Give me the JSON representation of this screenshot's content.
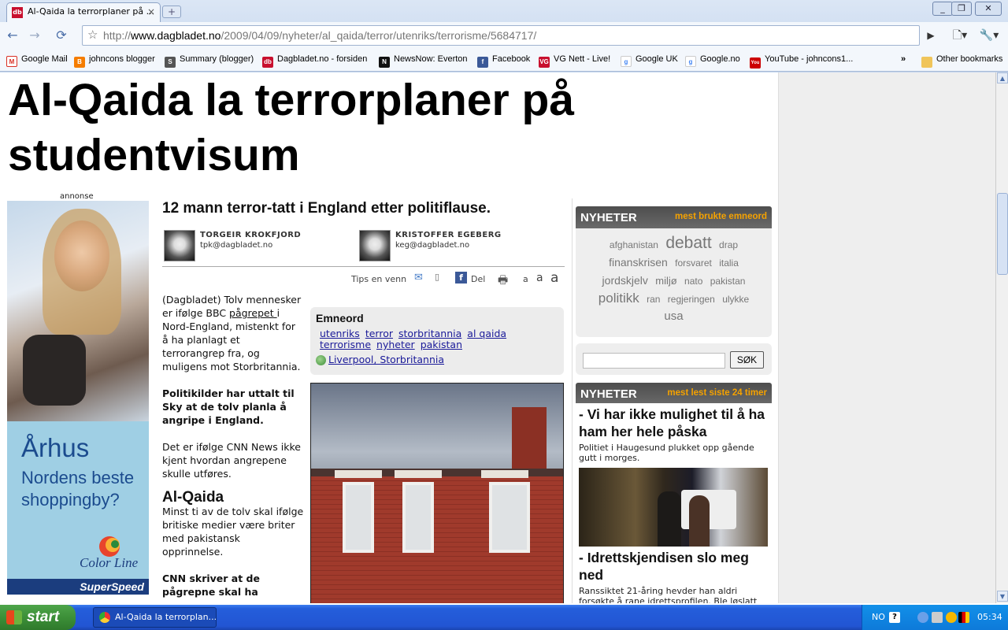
{
  "browser": {
    "tab_title": "Al-Qaida la terrorplaner på ...",
    "tab_favicon": "db",
    "url_prefix": "http://",
    "url_domain": "www.dagbladet.no",
    "url_path": "/2009/04/09/nyheter/al_qaida/terror/utenriks/terrorisme/5684717/"
  },
  "bookmarks": [
    {
      "label": "Google Mail",
      "icon": "gmail-icon",
      "color": "#d93025",
      "glyph": "M"
    },
    {
      "label": "johncons blogger",
      "icon": "blogger-icon",
      "color": "#f57d00",
      "glyph": "B"
    },
    {
      "label": "Summary (blogger)",
      "icon": "summary-icon",
      "color": "#555555",
      "glyph": "S"
    },
    {
      "label": "Dagbladet.no - forsiden",
      "icon": "dagbladet-icon",
      "color": "#c8102e",
      "glyph": "db"
    },
    {
      "label": "NewsNow: Everton",
      "icon": "newsnow-icon",
      "color": "#111111",
      "glyph": "N"
    },
    {
      "label": "Facebook",
      "icon": "facebook-icon",
      "color": "#3b5998",
      "glyph": "f"
    },
    {
      "label": "VG Nett - Live!",
      "icon": "vg-icon",
      "color": "#c8102e",
      "glyph": "VG"
    },
    {
      "label": "Google UK",
      "icon": "google-icon",
      "color": "#4285f4",
      "glyph": "g"
    },
    {
      "label": "Google.no",
      "icon": "google-icon",
      "color": "#4285f4",
      "glyph": "g"
    },
    {
      "label": "YouTube - johncons1...",
      "icon": "youtube-icon",
      "color": "#cc0000",
      "glyph": "You"
    }
  ],
  "bookmarks_more": "»",
  "other_bookmarks": "Other bookmarks",
  "article": {
    "headline": "Al-Qaida la terrorplaner på studentvisum",
    "ad_label": "annonse",
    "subheadline": "12 mann terror-tatt i England etter politiflause.",
    "authors": [
      {
        "name": "TORGEIR KROKFJORD",
        "email": "tpk@dagbladet.no"
      },
      {
        "name": "KRISTOFFER EGEBERG",
        "email": "keg@dagbladet.no"
      }
    ],
    "tools": {
      "tips": "Tips en venn",
      "share": "Del",
      "font_small": "a",
      "font_medium": "a",
      "font_large": "a"
    },
    "p1_before": "(Dagbladet) Tolv mennesker er ifølge BBC ",
    "p1_link": "pågrepet ",
    "p1_after": "i Nord-England, mistenkt for å ha planlagt et terrorangrep fra, og muligens mot Storbritannia.",
    "p2": "Politikilder har uttalt til Sky at de tolv planla å angripe i England.",
    "p3": "Det er ifølge CNN News ikke kjent hvordan angrepene skulle utføres.",
    "h_alqaida": "Al-Qaida",
    "p4": "Minst ti av de tolv skal ifølge britiske medier være briter med pakistansk opprinnelse.",
    "p5": "CNN skriver at de pågrepne skal ha"
  },
  "emneord": {
    "title": "Emneord",
    "tags": [
      "utenriks",
      "terror",
      "storbritannia",
      "al qaida",
      "terrorisme",
      "nyheter",
      "pakistan"
    ],
    "location": "Liverpool, Storbritannia"
  },
  "ad": {
    "city": "Århus",
    "tagline": "Nordens beste shoppingby?",
    "brand": "Color Line",
    "product": "SuperSpeed"
  },
  "sidebar": {
    "section1_title": "NYHETER",
    "section1_sub": "mest brukte emneord",
    "tag_cloud": [
      {
        "text": "afghanistan",
        "size": 12
      },
      {
        "text": "debatt",
        "size": 21
      },
      {
        "text": "drap",
        "size": 12
      },
      {
        "text": "finanskrisen",
        "size": 14
      },
      {
        "text": "forsvaret",
        "size": 12
      },
      {
        "text": "italia",
        "size": 12
      },
      {
        "text": "jordskjelv",
        "size": 14
      },
      {
        "text": "miljø",
        "size": 13
      },
      {
        "text": "nato",
        "size": 12
      },
      {
        "text": "pakistan",
        "size": 12
      },
      {
        "text": "politikk",
        "size": 17
      },
      {
        "text": "ran",
        "size": 12
      },
      {
        "text": "regjeringen",
        "size": 12
      },
      {
        "text": "ulykke",
        "size": 12
      },
      {
        "text": "usa",
        "size": 15
      }
    ],
    "search_button": "SØK",
    "section2_title": "NYHETER",
    "section2_sub": "mest lest siste 24 timer",
    "news": [
      {
        "headline": "- Vi har ikke mulighet til å ha ham her hele påska",
        "teaser": "Politiet i Haugesund plukket opp gående gutt i morges."
      },
      {
        "headline": "- Idrettskjendisen slo meg ned",
        "teaser": "Ranssiktet 21-åring hevder han aldri forsøkte å rane idrettsprofilen. Ble løslatt"
      }
    ]
  },
  "taskbar": {
    "start": "start",
    "task_item": "Al-Qaida la terrorplan...",
    "lang": "NO",
    "clock": "05:34"
  }
}
